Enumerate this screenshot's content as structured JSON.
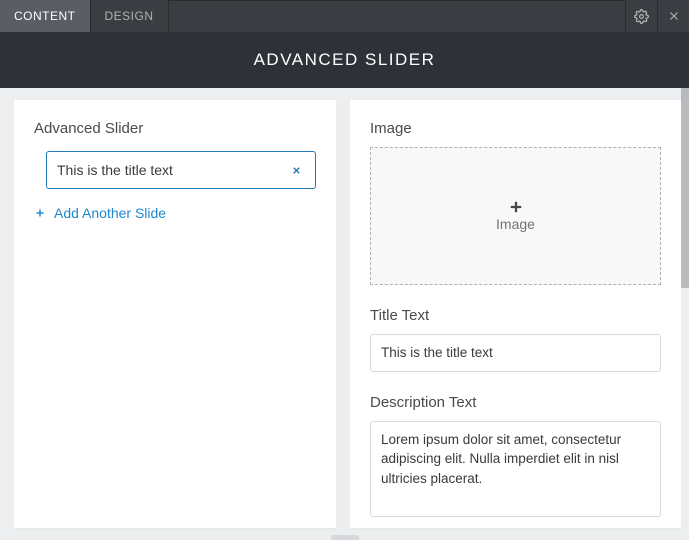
{
  "tabs": {
    "content": "CONTENT",
    "design": "DESIGN"
  },
  "header": {
    "title": "ADVANCED SLIDER"
  },
  "left": {
    "title": "Advanced Slider",
    "slides": [
      {
        "title": "This is the title text"
      }
    ],
    "add_label": "Add Another Slide"
  },
  "right": {
    "image_label": "Image",
    "image_drop_label": "Image",
    "title_label": "Title Text",
    "title_value": "This is the title text",
    "description_label": "Description Text",
    "description_value": "Lorem ipsum dolor sit amet, consectetur adipiscing elit. Nulla imperdiet elit in nisl ultricies placerat."
  }
}
